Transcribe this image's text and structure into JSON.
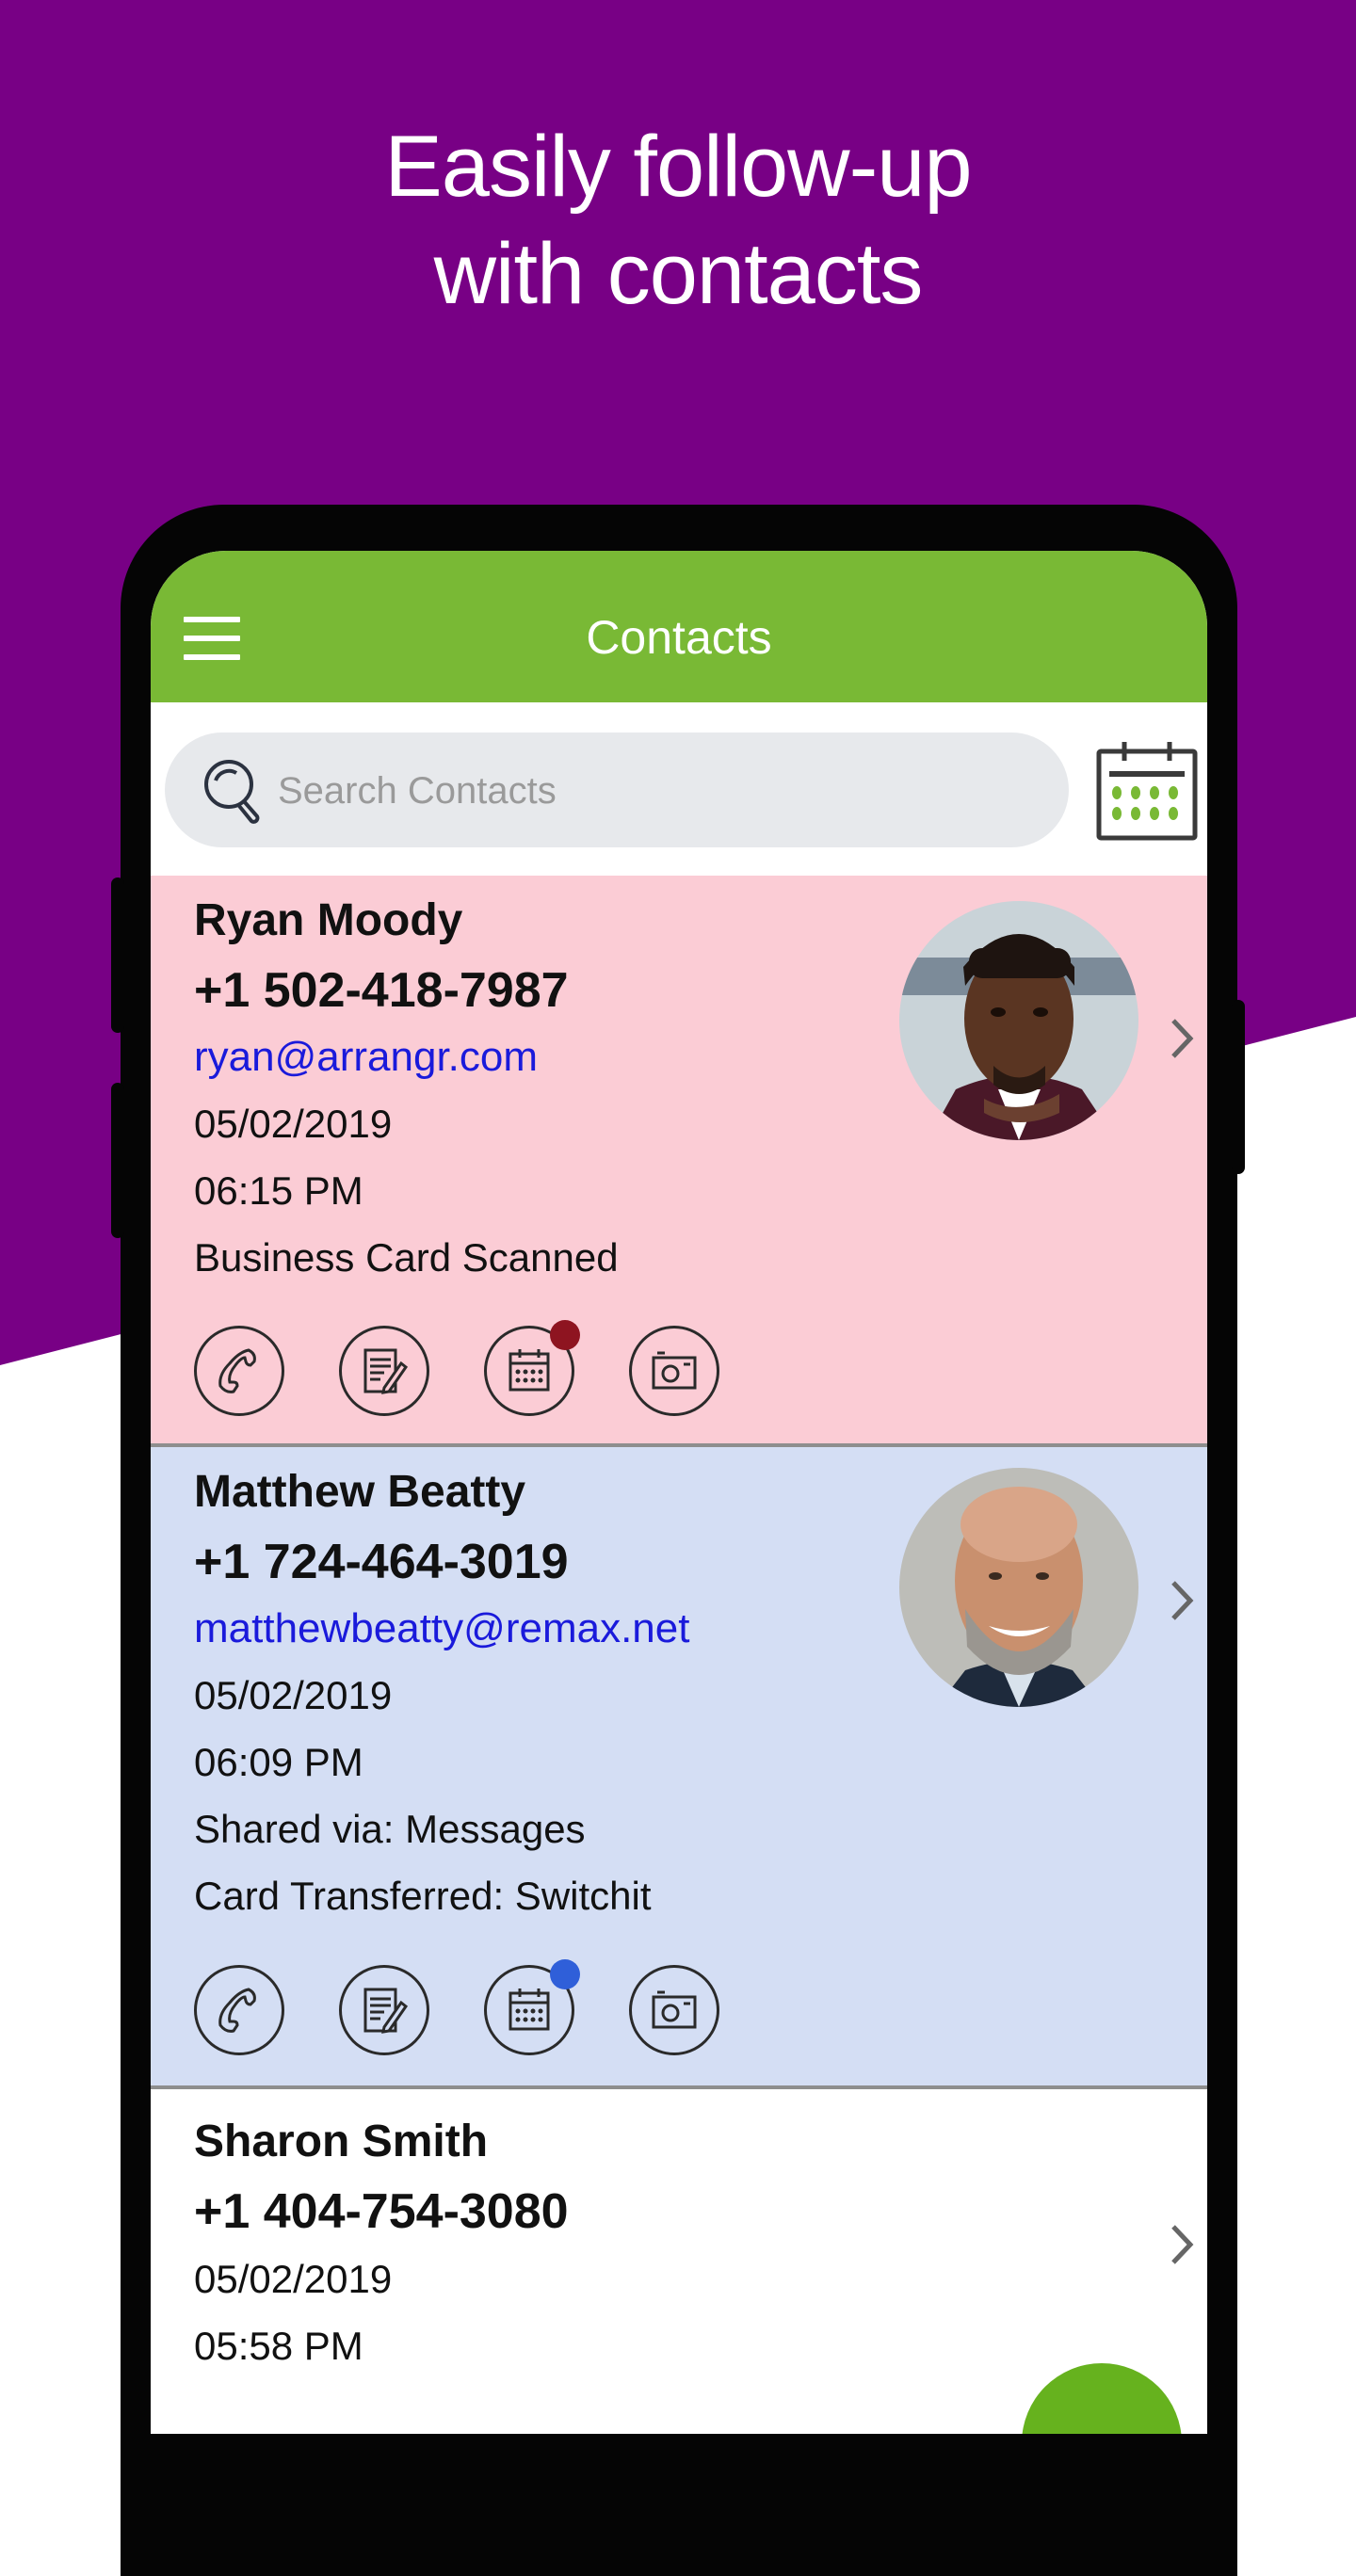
{
  "headline": {
    "line1": "Easily follow-up",
    "line2": "with contacts"
  },
  "colors": {
    "brand_purple": "#780085",
    "appbar_green": "#79B935",
    "fab_green": "#66B21E",
    "card_pink": "#FBCCD5",
    "card_blue": "#D4DEF4",
    "link_blue": "#1A1ADB",
    "badge_red": "#8E1420",
    "badge_blue": "#2F5FD9"
  },
  "appbar": {
    "title": "Contacts",
    "menu_icon": "hamburger-menu-icon"
  },
  "search": {
    "placeholder": "Search Contacts",
    "value": "",
    "icon": "search-icon",
    "calendar_icon": "calendar-icon"
  },
  "contacts": [
    {
      "name": "Ryan Moody",
      "phone": "+1 502-418-7987",
      "email": "ryan@arrangr.com",
      "date": "05/02/2019",
      "time": "06:15 PM",
      "notes": [
        "Business Card Scanned"
      ],
      "background": "#FBCCD5",
      "has_avatar": true,
      "calendar_badge": "#8E1420",
      "actions": [
        "phone-icon",
        "notes-icon",
        "calendar-icon",
        "camera-icon"
      ]
    },
    {
      "name": "Matthew Beatty",
      "phone": "+1 724-464-3019",
      "email": "matthewbeatty@remax.net",
      "date": "05/02/2019",
      "time": "06:09 PM",
      "notes": [
        "Shared via: Messages",
        "Card Transferred: Switchit"
      ],
      "background": "#D4DEF4",
      "has_avatar": true,
      "calendar_badge": "#2F5FD9",
      "actions": [
        "phone-icon",
        "notes-icon",
        "calendar-icon",
        "camera-icon"
      ]
    },
    {
      "name": "Sharon Smith",
      "phone": "+1 404-754-3080",
      "date": "05/02/2019",
      "time": "05:58 PM",
      "background": "#FFFFFF",
      "has_avatar": false
    }
  ],
  "fab": {
    "icon": "add-contact-icon"
  }
}
